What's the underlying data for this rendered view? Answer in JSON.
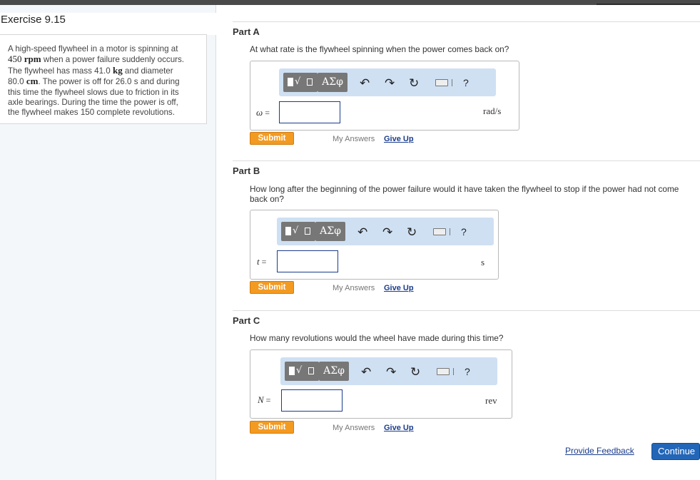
{
  "exercise": {
    "title": "Exercise 9.15"
  },
  "problem": {
    "t1": "A high-speed flywheel in a motor is spinning at",
    "t2a": "450",
    "t2b": " rpm",
    "t2c": " when a power failure suddenly occurs.",
    "t3": "The flywheel has mass 41.0",
    "t3b": " kg",
    "t3c": " and diameter",
    "t4": "80.0",
    "t4b": " cm",
    "t4c": ". The power is off for 26.0 s and during",
    "t5": "this time the flywheel slows due to friction in its",
    "t6": "axle bearings. During the time the power is off,",
    "t7": "the flywheel makes 150 complete revolutions."
  },
  "toolbar": {
    "greek_label": "ΑΣφ",
    "undo_glyph": "↶",
    "redo_glyph": "↷",
    "reset_glyph": "↻",
    "help_label": "?"
  },
  "parts": [
    {
      "title": "Part A",
      "question": "At what rate is the flywheel spinning when the power comes back on?",
      "var": "ω",
      "unit": "rad/s",
      "value": ""
    },
    {
      "title": "Part B",
      "question": "How long after the beginning of the power failure would it have taken the flywheel to stop if the power had not come back on?",
      "var": "t",
      "unit": "s",
      "value": ""
    },
    {
      "title": "Part C",
      "question": "How many revolutions would the wheel have made during this time?",
      "var": "N",
      "unit": "rev",
      "value": ""
    }
  ],
  "actions": {
    "submit": "Submit",
    "my_answers": "My Answers",
    "give_up": "Give Up",
    "equals": " =",
    "feedback": "Provide Feedback",
    "continue": "Continue"
  }
}
